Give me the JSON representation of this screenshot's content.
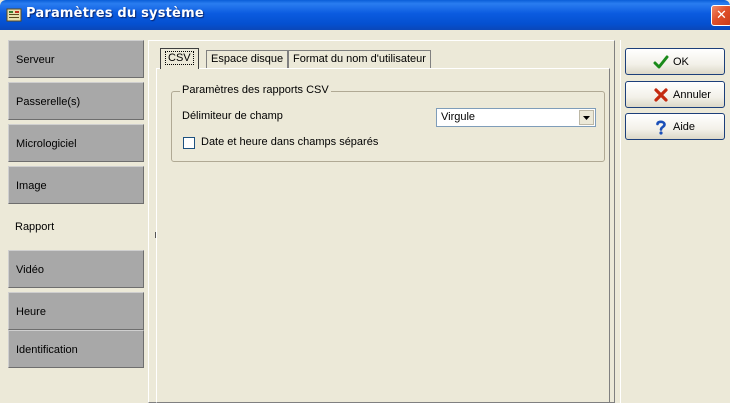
{
  "window": {
    "title": "Paramètres du système",
    "close_glyph": "✕"
  },
  "sidebar": {
    "items": [
      {
        "label": "Serveur"
      },
      {
        "label": "Passerelle(s)"
      },
      {
        "label": "Micrologiciel"
      },
      {
        "label": "Image"
      },
      {
        "label": "Rapport",
        "active": true
      },
      {
        "label": "Vidéo"
      },
      {
        "label": "Heure"
      },
      {
        "label": "Identification"
      }
    ]
  },
  "tabs": [
    {
      "label": "CSV",
      "active": true
    },
    {
      "label": "Espace disque"
    },
    {
      "label": "Format du nom d'utilisateur"
    }
  ],
  "csv": {
    "group_title": "Paramètres des rapports CSV",
    "delimiter_label": "Délimiteur de champ",
    "delimiter_value": "Virgule",
    "separate_datetime_label": "Date et heure dans champs séparés",
    "separate_datetime_checked": false
  },
  "buttons": {
    "ok": {
      "label": "OK",
      "icon": "check-icon"
    },
    "cancel": {
      "label": "Annuler",
      "icon": "x-icon"
    },
    "help": {
      "label": "Aide",
      "icon": "question-icon"
    }
  },
  "colors": {
    "titlebar": "#0b5be0",
    "sidebar_inactive": "#a8a8a8",
    "face": "#ece9d8",
    "close": "#e0502a"
  }
}
